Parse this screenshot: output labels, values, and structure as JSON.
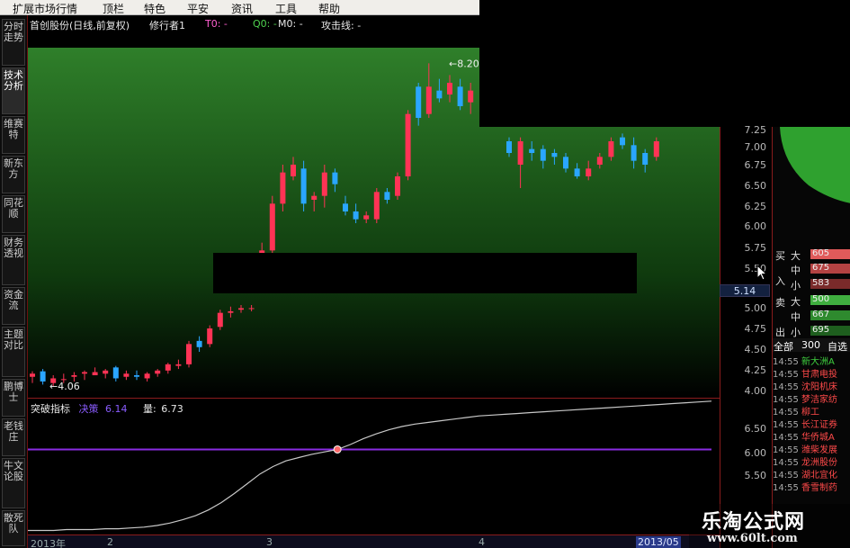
{
  "menu": [
    "扩展市场行情",
    "顶栏",
    "特色",
    "平安",
    "资讯",
    "工具",
    "帮助"
  ],
  "side_tabs": [
    "分时走势",
    "技术分析",
    "维赛特",
    "新东方",
    "同花顺",
    "财务透视",
    "资金流",
    "主题对比",
    "鹏博士",
    "老钱庄",
    "牛文论股",
    "散死队"
  ],
  "chart_header": {
    "title": "首创股份(日线,前复权)",
    "indicator_name": "修行者1",
    "t0": "T0: -",
    "q0": "Q0: -",
    "m0": "M0: -",
    "attack": "攻击线: -"
  },
  "price_axis": {
    "ticks": [
      "7.25",
      "7.00",
      "6.75",
      "6.50",
      "6.25",
      "6.00",
      "5.75",
      "5.50",
      "5.25",
      "5.00",
      "4.75",
      "4.50",
      "4.25",
      "4.00"
    ],
    "current_price": "5.14",
    "max_label": "8.20",
    "min_label": "4.06"
  },
  "sub_chart": {
    "name": "突破指标",
    "decision_label": "决策",
    "decision_value": "6.14",
    "volume_label": "量:",
    "volume_value": "6.73",
    "ticks": [
      "6.50",
      "6.00",
      "5.50"
    ]
  },
  "time_axis": [
    "2013年",
    "2",
    "3",
    "4",
    "2013/05"
  ],
  "order_book": {
    "side_labels": [
      "买",
      "入",
      "卖",
      "出"
    ],
    "size_labels": [
      "大",
      "中",
      "小",
      "大",
      "中",
      "小"
    ],
    "values": [
      "605",
      "675",
      "583",
      "500",
      "667",
      "695"
    ],
    "colors": [
      "#e05a5a",
      "#b44242",
      "#7a2a2a",
      "#3fae3f",
      "#2e8a2e",
      "#1e5e1e"
    ],
    "tab_all": "全部",
    "tab_300": "300",
    "tab_self": "自选"
  },
  "trades": [
    {
      "time": "14:55",
      "name": "新大洲A",
      "color": "#3fcf3f"
    },
    {
      "time": "14:55",
      "name": "甘肃电投",
      "color": "#ff4a4a"
    },
    {
      "time": "14:55",
      "name": "沈阳机床",
      "color": "#ff4a4a"
    },
    {
      "time": "14:55",
      "name": "梦洁家纺",
      "color": "#ff4a4a"
    },
    {
      "time": "14:55",
      "name": "柳工",
      "color": "#ff4a4a"
    },
    {
      "time": "14:55",
      "name": "长江证券",
      "color": "#ff4a4a"
    },
    {
      "time": "14:55",
      "name": "华侨城A",
      "color": "#ff4a4a"
    },
    {
      "time": "14:55",
      "name": "潍柴发展",
      "color": "#ff4a4a"
    },
    {
      "time": "14:55",
      "name": "龙洲股份",
      "color": "#ff4a4a"
    },
    {
      "time": "14:55",
      "name": "湖北宜化",
      "color": "#ff4a4a"
    },
    {
      "time": "14:55",
      "name": "香雪制药",
      "color": "#ff4a4a"
    }
  ],
  "watermark": {
    "title": "乐淘公式网",
    "url": "www.60lt.com"
  },
  "chart_data": {
    "type": "candlestick",
    "price_ylim": [
      3.9,
      8.4
    ],
    "candles": [
      {
        "o": 4.18,
        "h": 4.25,
        "l": 4.1,
        "c": 4.22,
        "up": true
      },
      {
        "o": 4.25,
        "h": 4.28,
        "l": 4.08,
        "c": 4.12,
        "up": false
      },
      {
        "o": 4.1,
        "h": 4.2,
        "l": 4.06,
        "c": 4.16,
        "up": true
      },
      {
        "o": 4.15,
        "h": 4.22,
        "l": 4.1,
        "c": 4.14,
        "up": true
      },
      {
        "o": 4.18,
        "h": 4.24,
        "l": 4.12,
        "c": 4.2,
        "up": true
      },
      {
        "o": 4.22,
        "h": 4.26,
        "l": 4.14,
        "c": 4.24,
        "up": true
      },
      {
        "o": 4.24,
        "h": 4.3,
        "l": 4.2,
        "c": 4.2,
        "up": true
      },
      {
        "o": 4.22,
        "h": 4.28,
        "l": 4.16,
        "c": 4.26,
        "up": true
      },
      {
        "o": 4.3,
        "h": 4.32,
        "l": 4.12,
        "c": 4.16,
        "up": false
      },
      {
        "o": 4.18,
        "h": 4.26,
        "l": 4.14,
        "c": 4.22,
        "up": true
      },
      {
        "o": 4.2,
        "h": 4.26,
        "l": 4.14,
        "c": 4.18,
        "up": false
      },
      {
        "o": 4.16,
        "h": 4.24,
        "l": 4.12,
        "c": 4.22,
        "up": true
      },
      {
        "o": 4.22,
        "h": 4.28,
        "l": 4.18,
        "c": 4.26,
        "up": true
      },
      {
        "o": 4.26,
        "h": 4.36,
        "l": 4.22,
        "c": 4.34,
        "up": true
      },
      {
        "o": 4.34,
        "h": 4.4,
        "l": 4.28,
        "c": 4.32,
        "up": true
      },
      {
        "o": 4.34,
        "h": 4.64,
        "l": 4.3,
        "c": 4.6,
        "up": true
      },
      {
        "o": 4.64,
        "h": 4.7,
        "l": 4.5,
        "c": 4.56,
        "up": false
      },
      {
        "o": 4.6,
        "h": 4.84,
        "l": 4.56,
        "c": 4.8,
        "up": true
      },
      {
        "o": 4.82,
        "h": 5.04,
        "l": 4.78,
        "c": 5.0,
        "up": true
      },
      {
        "o": 5.0,
        "h": 5.08,
        "l": 4.94,
        "c": 5.02,
        "up": true
      },
      {
        "o": 5.06,
        "h": 5.1,
        "l": 5.0,
        "c": 5.04,
        "up": true
      },
      {
        "o": 5.06,
        "h": 5.1,
        "l": 5.02,
        "c": 5.06,
        "up": true
      },
      {
        "o": 5.7,
        "h": 5.9,
        "l": 5.6,
        "c": 5.8,
        "up": true
      },
      {
        "o": 5.8,
        "h": 6.5,
        "l": 5.75,
        "c": 6.4,
        "up": true
      },
      {
        "o": 6.4,
        "h": 6.9,
        "l": 6.3,
        "c": 6.8,
        "up": true
      },
      {
        "o": 6.75,
        "h": 7.0,
        "l": 6.7,
        "c": 6.9,
        "up": true
      },
      {
        "o": 6.85,
        "h": 6.95,
        "l": 6.3,
        "c": 6.4,
        "up": false
      },
      {
        "o": 6.45,
        "h": 6.55,
        "l": 6.3,
        "c": 6.5,
        "up": true
      },
      {
        "o": 6.5,
        "h": 6.9,
        "l": 6.35,
        "c": 6.8,
        "up": true
      },
      {
        "o": 6.8,
        "h": 6.85,
        "l": 6.55,
        "c": 6.65,
        "up": false
      },
      {
        "o": 6.4,
        "h": 6.5,
        "l": 6.25,
        "c": 6.3,
        "up": false
      },
      {
        "o": 6.3,
        "h": 6.4,
        "l": 6.15,
        "c": 6.2,
        "up": false
      },
      {
        "o": 6.2,
        "h": 6.3,
        "l": 6.15,
        "c": 6.25,
        "up": true
      },
      {
        "o": 6.2,
        "h": 6.6,
        "l": 6.15,
        "c": 6.55,
        "up": true
      },
      {
        "o": 6.55,
        "h": 6.6,
        "l": 6.4,
        "c": 6.45,
        "up": false
      },
      {
        "o": 6.5,
        "h": 6.8,
        "l": 6.45,
        "c": 6.75,
        "up": true
      },
      {
        "o": 6.75,
        "h": 7.6,
        "l": 6.7,
        "c": 7.55,
        "up": true
      },
      {
        "o": 7.5,
        "h": 7.95,
        "l": 7.4,
        "c": 7.9,
        "up": false
      },
      {
        "o": 7.55,
        "h": 8.2,
        "l": 7.5,
        "c": 7.9,
        "up": true
      },
      {
        "o": 7.85,
        "h": 8.0,
        "l": 7.7,
        "c": 7.75,
        "up": false
      },
      {
        "o": 7.8,
        "h": 8.05,
        "l": 7.7,
        "c": 7.95,
        "up": true
      },
      {
        "o": 7.9,
        "h": 8.0,
        "l": 7.6,
        "c": 7.65,
        "up": false
      },
      {
        "o": 7.7,
        "h": 7.95,
        "l": 7.55,
        "c": 7.85,
        "up": true
      }
    ],
    "later_candles": [
      {
        "o": 7.2,
        "h": 7.25,
        "l": 7.0,
        "c": 7.05,
        "up": false
      },
      {
        "o": 7.2,
        "h": 7.25,
        "l": 6.6,
        "c": 6.9,
        "up": true
      },
      {
        "o": 7.1,
        "h": 7.2,
        "l": 6.95,
        "c": 7.05,
        "up": false
      },
      {
        "o": 7.1,
        "h": 7.15,
        "l": 6.85,
        "c": 6.95,
        "up": false
      },
      {
        "o": 7.05,
        "h": 7.1,
        "l": 6.9,
        "c": 7.0,
        "up": false
      },
      {
        "o": 7.0,
        "h": 7.05,
        "l": 6.8,
        "c": 6.85,
        "up": false
      },
      {
        "o": 6.85,
        "h": 6.92,
        "l": 6.72,
        "c": 6.75,
        "up": false
      },
      {
        "o": 6.75,
        "h": 6.95,
        "l": 6.7,
        "c": 6.85,
        "up": true
      },
      {
        "o": 6.9,
        "h": 7.05,
        "l": 6.85,
        "c": 7.0,
        "up": true
      },
      {
        "o": 7.0,
        "h": 7.25,
        "l": 6.95,
        "c": 7.2,
        "up": true
      },
      {
        "o": 7.25,
        "h": 7.3,
        "l": 7.1,
        "c": 7.15,
        "up": false
      },
      {
        "o": 7.15,
        "h": 7.25,
        "l": 6.85,
        "c": 6.95,
        "up": false
      },
      {
        "o": 7.05,
        "h": 7.1,
        "l": 6.8,
        "c": 6.9,
        "up": false
      },
      {
        "o": 7.0,
        "h": 7.25,
        "l": 6.95,
        "c": 7.2,
        "up": true
      }
    ],
    "sub_ylim": [
      5.1,
      6.75
    ],
    "decision_line": 6.14,
    "volume_curve": [
      5.15,
      5.15,
      5.15,
      5.16,
      5.16,
      5.16,
      5.17,
      5.17,
      5.18,
      5.19,
      5.21,
      5.24,
      5.28,
      5.33,
      5.4,
      5.49,
      5.6,
      5.72,
      5.84,
      5.93,
      6.0,
      6.04,
      6.08,
      6.11,
      6.14,
      6.2,
      6.27,
      6.33,
      6.38,
      6.42,
      6.45,
      6.47,
      6.49,
      6.51,
      6.53,
      6.55,
      6.56,
      6.57,
      6.58,
      6.59,
      6.6,
      6.61,
      6.62,
      6.63,
      6.64,
      6.65,
      6.66,
      6.67,
      6.68,
      6.69,
      6.7,
      6.71,
      6.72,
      6.73
    ]
  }
}
